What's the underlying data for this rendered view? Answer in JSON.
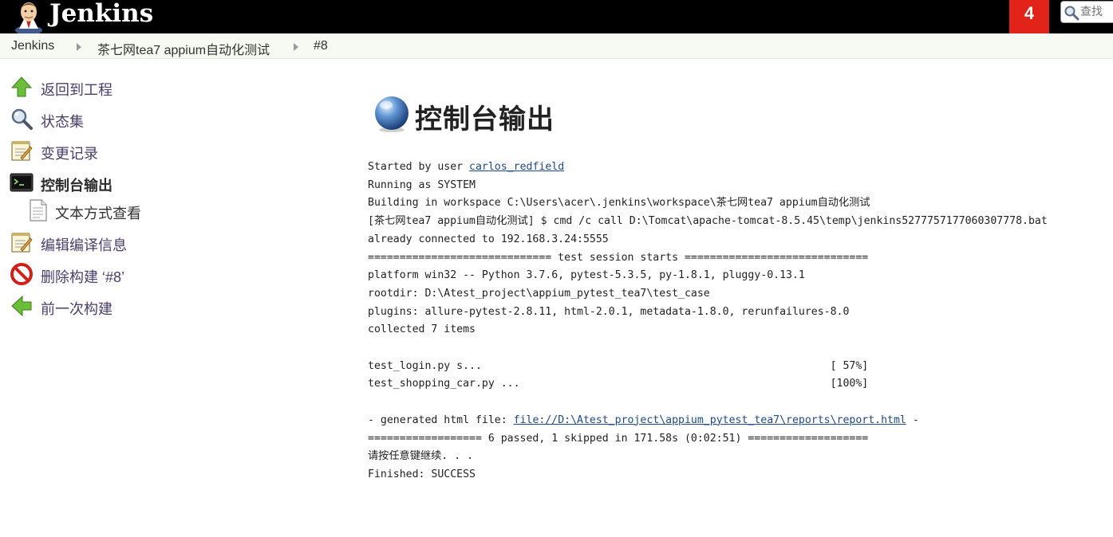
{
  "header": {
    "brand": "Jenkins",
    "notification_count": "4",
    "search_placeholder": "查找"
  },
  "breadcrumb": {
    "items": [
      "Jenkins",
      "茶七网tea7 appium自动化测试",
      "#8"
    ]
  },
  "side_panel": {
    "tasks": [
      {
        "label": "返回到工程",
        "icon": "up-arrow-icon"
      },
      {
        "label": "状态集",
        "icon": "search-icon"
      },
      {
        "label": "变更记录",
        "icon": "notepad-icon"
      },
      {
        "label": "控制台输出",
        "icon": "terminal-icon",
        "current": true
      },
      {
        "label": "文本方式查看",
        "icon": "document-icon",
        "sub": true
      },
      {
        "label": "编辑编译信息",
        "icon": "notepad-icon"
      },
      {
        "label": "删除构建 ‘#8’",
        "icon": "no-entry-icon"
      },
      {
        "label": "前一次构建",
        "icon": "left-arrow-icon"
      }
    ]
  },
  "main": {
    "title": "控制台输出",
    "console": {
      "started_prefix": "Started by user ",
      "started_user": "carlos_redfield",
      "lines_a": [
        "Running as SYSTEM",
        "Building in workspace C:\\Users\\acer\\.jenkins\\workspace\\茶七网tea7 appium自动化测试",
        "[茶七网tea7 appium自动化测试] $ cmd /c call D:\\Tomcat\\apache-tomcat-8.5.45\\temp\\jenkins5277757177060307778.bat",
        "already connected to 192.168.3.24:5555",
        "============================= test session starts =============================",
        "platform win32 -- Python 3.7.6, pytest-5.3.5, py-1.8.1, pluggy-0.13.1",
        "rootdir: D:\\Atest_project\\appium_pytest_tea7\\test_case",
        "plugins: allure-pytest-2.8.11, html-2.0.1, metadata-1.8.0, rerunfailures-8.0",
        "collected 7 items",
        "",
        "test_login.py s...                                                       [ 57%]",
        "test_shopping_car.py ...                                                 [100%]",
        ""
      ],
      "generated_prefix": "- generated html file: ",
      "generated_link": "file://D:\\Atest_project\\appium_pytest_tea7\\reports\\report.html",
      "generated_suffix": " -",
      "lines_b": [
        "================== 6 passed, 1 skipped in 171.58s (0:02:51) ===================",
        "请按任意键继续. . .",
        "Finished: SUCCESS"
      ]
    }
  },
  "colors": {
    "header_bg": "#000000",
    "notification_bg": "#e2231a",
    "breadcrumb_bg": "#f6faf2",
    "link": "#204a87",
    "task_label": "#4a3e6b"
  }
}
